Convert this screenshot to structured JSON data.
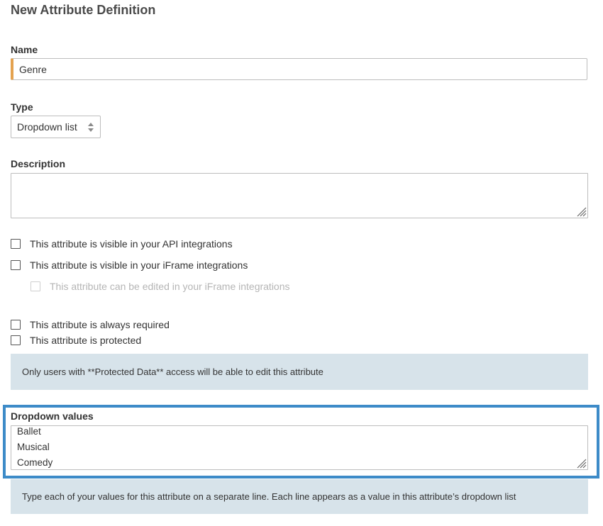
{
  "page": {
    "title": "New Attribute Definition"
  },
  "name_field": {
    "label": "Name",
    "value": "Genre"
  },
  "type_field": {
    "label": "Type",
    "selected": "Dropdown list"
  },
  "description_field": {
    "label": "Description",
    "value": ""
  },
  "checkboxes": [
    {
      "label": "This attribute is visible in your API integrations",
      "checked": false,
      "disabled": false
    },
    {
      "label": "This attribute is visible in your iFrame integrations",
      "checked": false,
      "disabled": false
    },
    {
      "label": "This attribute can be edited in your iFrame integrations",
      "checked": false,
      "disabled": true
    },
    {
      "label": "This attribute is always required",
      "checked": false,
      "disabled": false
    },
    {
      "label": "This attribute is protected",
      "checked": false,
      "disabled": false
    }
  ],
  "protected_note": "Only users with **Protected Data** access will be able to edit this attribute",
  "dropdown_values": {
    "label": "Dropdown values",
    "lines": [
      "Ballet",
      "Musical",
      "Comedy"
    ],
    "help": "Type each of your values for this attribute on a separate line. Each line appears as a value in this attribute’s dropdown list"
  },
  "colors": {
    "accent_border": "#e4a24f",
    "highlight": "#3d8bc8",
    "info_bg": "#d7e3ea"
  }
}
